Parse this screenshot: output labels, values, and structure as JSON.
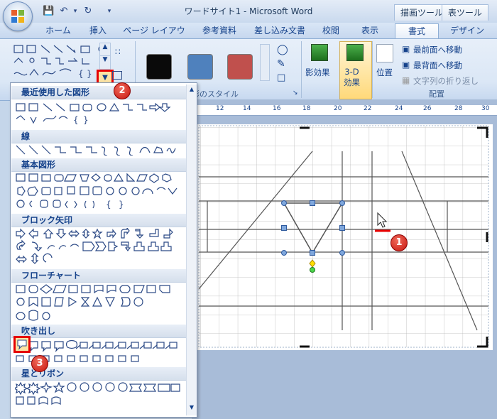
{
  "window": {
    "title": "ワードサイト1 - Microsoft Word",
    "context_tabs": [
      "描画ツール",
      "表ツール"
    ]
  },
  "ribbon_tabs": [
    "ホーム",
    "挿入",
    "ページ レイアウト",
    "参考資料",
    "差し込み文書",
    "校閲",
    "表示",
    "書式",
    "デザイン"
  ],
  "ribbon": {
    "shape_styles_label": "形のスタイル",
    "shadow_effects": "影効果",
    "three_d_effects": "3-D\n効果",
    "position": "位置",
    "bring_to_front": "最前面へ移動",
    "send_to_back": "最背面へ移動",
    "text_wrapping": "文字列の折り返し",
    "arrange_label": "配置",
    "swatch_colors": [
      "#0a0a0a",
      "#4f81bd",
      "#c0504d"
    ]
  },
  "ruler_ticks": [
    "12",
    "14",
    "16",
    "18",
    "20",
    "22",
    "24",
    "26",
    "28",
    "30"
  ],
  "dropdown": {
    "categories": [
      "最近使用した図形",
      "線",
      "基本図形",
      "ブロック矢印",
      "フローチャート",
      "吹き出し",
      "星とリボン"
    ]
  },
  "badges": [
    "1",
    "2",
    "3"
  ]
}
